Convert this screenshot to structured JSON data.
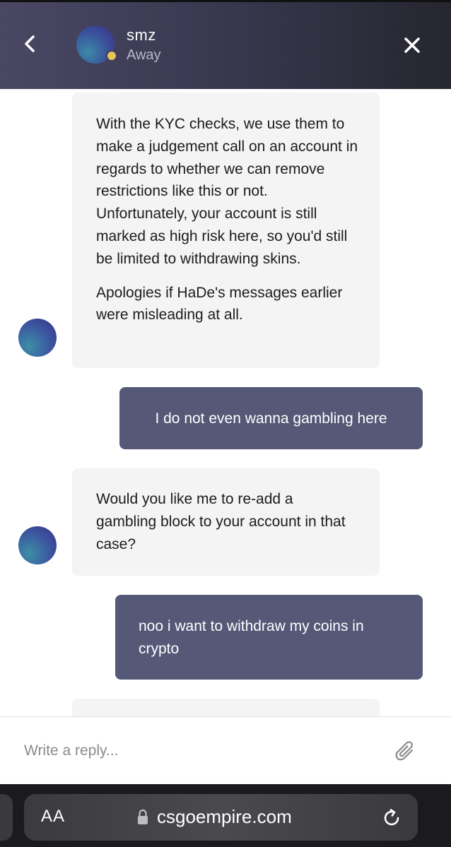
{
  "header": {
    "agent_name": "smz",
    "status": "Away",
    "presence_color": "#e6c65c",
    "back_icon": "chevron-left-icon",
    "close_icon": "close-icon"
  },
  "messages": [
    {
      "sender": "agent",
      "paragraphs": [
        "With the KYC checks, we use them to make a judgement call on an account in regards to whether we can remove restrictions like this or not. Unfortunately, your account is still marked as high risk here, so you'd still be limited to withdrawing skins.",
        "Apologies if HaDe's messages earlier were misleading at all."
      ]
    },
    {
      "sender": "user",
      "text": "I do not even wanna gambling here"
    },
    {
      "sender": "agent",
      "text": "Would you like me to re-add a gambling block to your account in that case?"
    },
    {
      "sender": "user",
      "text": "noo i want to withdraw my coins in crypto"
    }
  ],
  "reply": {
    "placeholder": "Write a reply...",
    "attach_icon": "paperclip-icon"
  },
  "browser": {
    "text_size_label": "AA",
    "url": "csgoempire.com",
    "lock_icon": "lock-icon",
    "reload_icon": "reload-icon"
  },
  "colors": {
    "header_bg": "#3f3d57",
    "user_bubble": "#555877",
    "agent_bubble": "#f4f4f4"
  }
}
